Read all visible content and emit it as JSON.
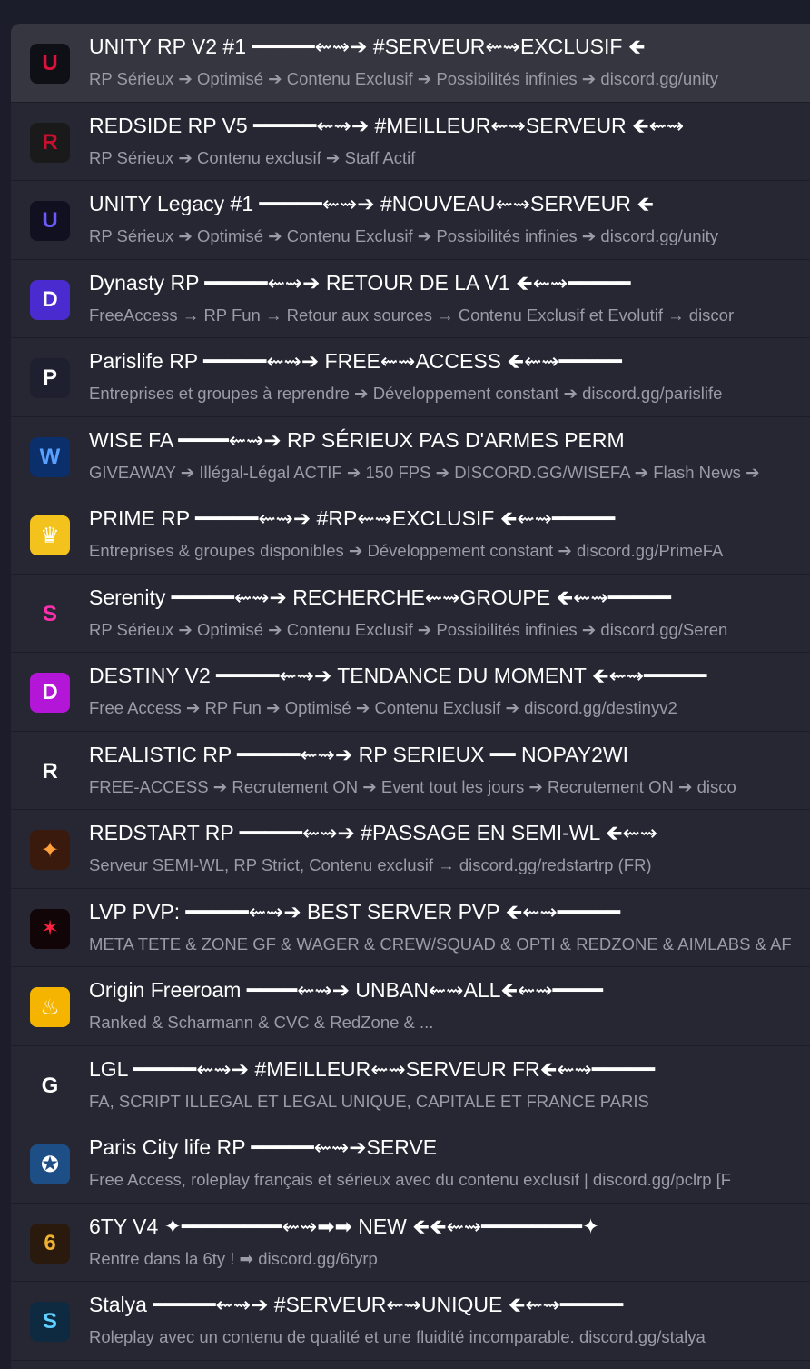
{
  "servers": [
    {
      "title": "UNITY RP V2 #1 ━━━━━⇜⇝➔ #SERVEUR⇜⇝EXCLUSIF 🡸",
      "description": "RP Sérieux ➔ Optimisé ➔ Contenu Exclusif ➔ Possibilités infinies ➔ discord.gg/unity",
      "logo_icon": "unity-shield-icon",
      "logo_bg": "#0f1015",
      "logo_fg": "#e0103c"
    },
    {
      "title": "REDSIDE RP V5 ━━━━━⇜⇝➔ #MEILLEUR⇜⇝SERVEUR 🡸⇜⇝",
      "description": "RP Sérieux ➔ Contenu exclusif ➔ Staff Actif",
      "logo_icon": "redside-emblem-icon",
      "logo_bg": "#1a1a1a",
      "logo_fg": "#c8102e"
    },
    {
      "title": "UNITY Legacy #1 ━━━━━⇜⇝➔ #NOUVEAU⇜⇝SERVEUR 🡸",
      "description": "RP Sérieux ➔ Optimisé ➔ Contenu Exclusif ➔ Possibilités infinies ➔ discord.gg/unity",
      "logo_icon": "unity-legacy-shield-icon",
      "logo_bg": "#101020",
      "logo_fg": "#6b5bff"
    },
    {
      "title": "Dynasty RP ━━━━━⇜⇝➔ RETOUR DE LA V1 🡸⇜⇝━━━━━",
      "description": "FreeAccess → RP Fun → Retour aux sources → Contenu Exclusif et Evolutif → discor",
      "logo_icon": "dynasty-d-icon",
      "logo_bg": "#4a2bd0",
      "logo_fg": "#ffffff"
    },
    {
      "title": "Parislife RP ━━━━━⇜⇝➔ FREE⇜⇝ACCESS 🡸⇜⇝━━━━━",
      "description": "Entreprises et groupes à reprendre ➔ Développement constant ➔ discord.gg/parislife",
      "logo_icon": "parislife-p-icon",
      "logo_bg": "#1e2030",
      "logo_fg": "#ffffff"
    },
    {
      "title": "WISE FA ━━━━⇜⇝➔ RP SÉRIEUX PAS D'ARMES PERM",
      "description": "GIVEAWAY ➔ Illégal-Légal ACTIF ➔ 150 FPS ➔ DISCORD.GG/WISEFA ➔ Flash News ➔",
      "logo_icon": "wise-wave-icon",
      "logo_bg": "#0b2f6b",
      "logo_fg": "#5aa0ff"
    },
    {
      "title": "PRIME RP ━━━━━⇜⇝➔ #RP⇜⇝EXCLUSIF 🡸⇜⇝━━━━━",
      "description": "Entreprises & groupes disponibles ➔ Développement constant ➔ discord.gg/PrimeFA",
      "logo_icon": "prime-crown-icon",
      "logo_bg": "#f4c21c",
      "logo_fg": "#ffffff"
    },
    {
      "title": "Serenity ━━━━━⇜⇝➔ RECHERCHE⇜⇝GROUPE 🡸⇜⇝━━━━━",
      "description": "RP Sérieux ➔ Optimisé ➔ Contenu Exclusif ➔ Possibilités infinies ➔ discord.gg/Seren",
      "logo_icon": "serenity-s-icon",
      "logo_bg": "#262733",
      "logo_fg": "#ff2fae"
    },
    {
      "title": "DESTINY V2 ━━━━━⇜⇝➔ TENDANCE DU MOMENT 🡸⇜⇝━━━━━",
      "description": "Free Access ➔ RP Fun ➔ Optimisé ➔ Contenu Exclusif ➔ discord.gg/destinyv2",
      "logo_icon": "destiny-d-icon",
      "logo_bg": "#b316d6",
      "logo_fg": "#ffffff"
    },
    {
      "title": "REALISTIC RP ━━━━━⇜⇝➔ RP SERIEUX ━━ NOPAY2WI",
      "description": "FREE-ACCESS ➔ Recrutement ON ➔ Event tout les jours ➔ Recrutement ON ➔ disco",
      "logo_icon": "realistic-r-icon",
      "logo_bg": "#262733",
      "logo_fg": "#ffffff"
    },
    {
      "title": "REDSTART RP ━━━━━⇜⇝➔ #PASSAGE EN SEMI-WL 🡸⇜⇝",
      "description": "Serveur SEMI-WL, RP Strict, Contenu exclusif → discord.gg/redstartrp (FR)",
      "logo_icon": "redstart-flame-icon",
      "logo_bg": "#3a1a0c",
      "logo_fg": "#ffa03a"
    },
    {
      "title": "LVP PVP: ━━━━━⇜⇝➔ BEST SERVER PVP 🡸⇜⇝━━━━━",
      "description": "META TETE & ZONE GF & WAGER & CREW/SQUAD & OPTI & REDZONE & AIMLABS & AF",
      "logo_icon": "lvp-logo-icon",
      "logo_bg": "#120508",
      "logo_fg": "#ff2340"
    },
    {
      "title": "Origin Freeroam ━━━━⇜⇝➔ UNBAN⇜⇝ALL🡸⇜⇝━━━━",
      "description": "Ranked & Scharmann & CVC & RedZone & ...",
      "logo_icon": "origin-flame-icon",
      "logo_bg": "#f5b400",
      "logo_fg": "#ffffff"
    },
    {
      "title": "LGL ━━━━━⇜⇝➔ #MEILLEUR⇜⇝SERVEUR FR🡸⇜⇝━━━━━",
      "description": "FA, SCRIPT ILLEGAL ET LEGAL UNIQUE, CAPITALE ET FRANCE PARIS",
      "logo_icon": "lgl-g-crown-icon",
      "logo_bg": "#262733",
      "logo_fg": "#ffffff"
    },
    {
      "title": "Paris City life RP ━━━━━⇜⇝➔SERVE",
      "description": "Free Access, roleplay français et sérieux avec du contenu exclusif | discord.gg/pclrp [F",
      "logo_icon": "paris-city-emblem-icon",
      "logo_bg": "#1d4e86",
      "logo_fg": "#ffffff"
    },
    {
      "title": "6TY V4 ✦━━━━━━━━⇜⇝➡➡ NEW 🡸🡸⇜⇝━━━━━━━━✦",
      "description": "Rentre dans la 6ty ! ➡ discord.gg/6tyrp",
      "logo_icon": "sixty-logo-icon",
      "logo_bg": "#2a1a0e",
      "logo_fg": "#f0b030"
    },
    {
      "title": "Stalya ━━━━━⇜⇝➔ #SERVEUR⇜⇝UNIQUE 🡸⇜⇝━━━━━",
      "description": "Roleplay avec un contenu de qualité et une fluidité incomparable. discord.gg/stalya",
      "logo_icon": "stalya-s-icon",
      "logo_bg": "#0e2a40",
      "logo_fg": "#5fd0ff"
    }
  ]
}
